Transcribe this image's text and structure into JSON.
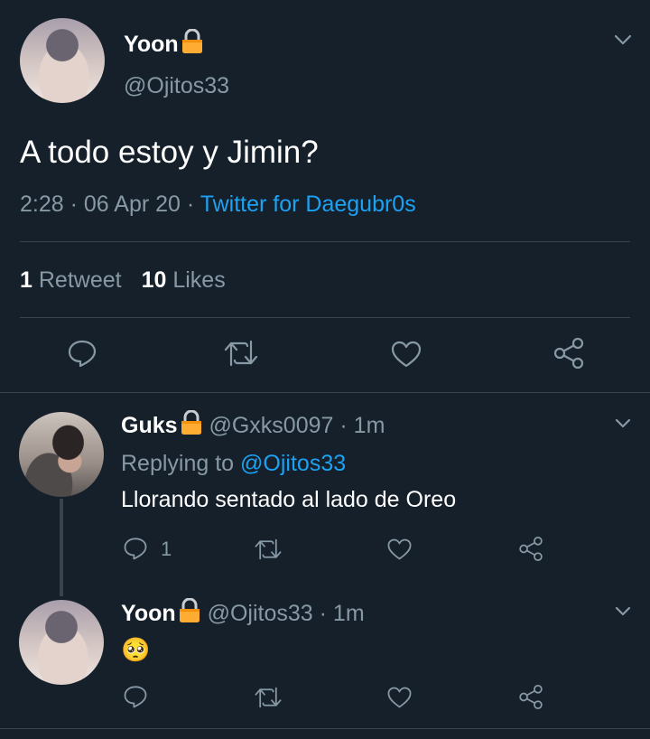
{
  "main_tweet": {
    "display_name": "Yoon",
    "handle": "@Ojitos33",
    "text": "A todo estoy y Jimin?",
    "time": "2:28",
    "date": "06 Apr 20",
    "source": "Twitter for Daegubr0s",
    "retweet_count": "1",
    "retweet_label": "Retweet",
    "like_count": "10",
    "like_label": "Likes"
  },
  "replies": [
    {
      "display_name": "Guks",
      "handle": "@Gxks0097",
      "age": "1m",
      "replying_prefix": "Replying to",
      "replying_handle": "@Ojitos33",
      "text": "Llorando sentado al lado de Oreo",
      "reply_count": "1"
    },
    {
      "display_name": "Yoon",
      "handle": "@Ojitos33",
      "age": "1m",
      "text": "🥺"
    }
  ],
  "separator": "·",
  "icons": {
    "menu": "chevron-down-icon",
    "reply": "reply-icon",
    "retweet": "retweet-icon",
    "like": "heart-icon",
    "share": "share-icon",
    "lock": "lock-icon"
  },
  "colors": {
    "background": "#15202b",
    "text": "#ffffff",
    "muted": "#8899a6",
    "accent": "#1da1f2",
    "divider": "#38444d",
    "lock": "#ffac33"
  }
}
